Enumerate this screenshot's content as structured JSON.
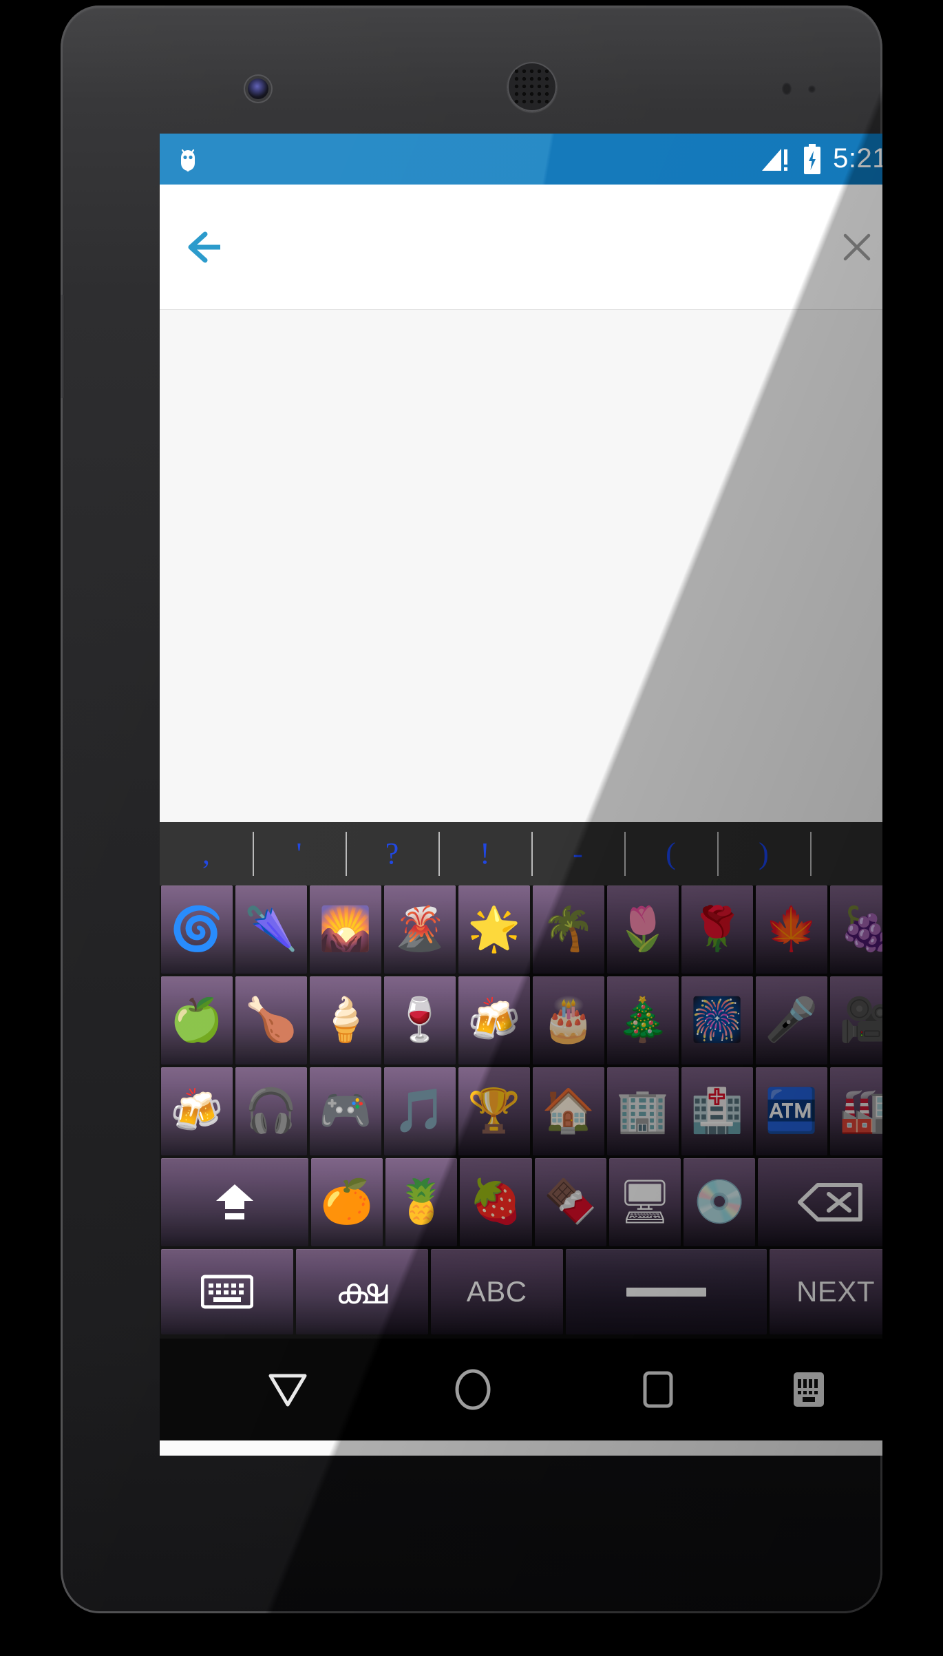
{
  "device": {
    "name": "android-phone-nexus",
    "hardware": [
      "front-camera",
      "earpiece",
      "proximity-sensor",
      "power-button",
      "volume-button"
    ]
  },
  "status_bar": {
    "notification_icon": "android-robot-icon",
    "signal_icon": "signal-triangle-warning-icon",
    "battery_icon": "battery-charging-icon",
    "clock": "5:21",
    "background_color": "#1f86c4"
  },
  "app_bar": {
    "back_icon": "back-arrow-icon",
    "back_color": "#2196c9",
    "close_icon": "close-x-icon",
    "close_color": "#9e9e9e",
    "background_color": "#ffffff",
    "title": ""
  },
  "content": {
    "text": "",
    "background_color": "#f7f7f7"
  },
  "keyboard": {
    "theme_key_color": "#6e5578",
    "suggestion_text_color": "#1840e0",
    "suggestion_bar_color": "#2c2c2c",
    "suggestions": [
      {
        "label": ",",
        "name": "comma"
      },
      {
        "label": "'",
        "name": "apostrophe"
      },
      {
        "label": "?",
        "name": "question-mark"
      },
      {
        "label": "!",
        "name": "exclamation-mark"
      },
      {
        "label": "-",
        "name": "hyphen"
      },
      {
        "label": "(",
        "name": "open-paren"
      },
      {
        "label": ")",
        "name": "close-paren"
      },
      {
        "label": "",
        "name": "empty"
      }
    ],
    "rows": [
      [
        {
          "glyph": "🌀",
          "name": "emoji-cyclone"
        },
        {
          "glyph": "🌂",
          "name": "emoji-closed-umbrella"
        },
        {
          "glyph": "🌄",
          "name": "emoji-sunrise-over-mountains"
        },
        {
          "glyph": "🌋",
          "name": "emoji-volcano"
        },
        {
          "glyph": "🌟",
          "name": "emoji-glowing-star"
        },
        {
          "glyph": "🌴",
          "name": "emoji-palm-tree"
        },
        {
          "glyph": "🌷",
          "name": "emoji-tulip"
        },
        {
          "glyph": "🌹",
          "name": "emoji-rose"
        },
        {
          "glyph": "🍁",
          "name": "emoji-maple-leaf"
        },
        {
          "glyph": "🍇",
          "name": "emoji-grapes"
        }
      ],
      [
        {
          "glyph": "🍏",
          "name": "emoji-green-apple"
        },
        {
          "glyph": "🍗",
          "name": "emoji-poultry-leg"
        },
        {
          "glyph": "🍦",
          "name": "emoji-soft-ice-cream"
        },
        {
          "glyph": "🍷",
          "name": "emoji-wine-glass"
        },
        {
          "glyph": "🍻",
          "name": "emoji-clinking-beer-mugs"
        },
        {
          "glyph": "🎂",
          "name": "emoji-birthday-cake"
        },
        {
          "glyph": "🎄",
          "name": "emoji-christmas-tree"
        },
        {
          "glyph": "🎆",
          "name": "emoji-fireworks"
        },
        {
          "glyph": "🎤",
          "name": "emoji-microphone"
        },
        {
          "glyph": "🎥",
          "name": "emoji-movie-camera"
        }
      ],
      [
        {
          "glyph": "🍻",
          "name": "emoji-clinking-beer-mugs-2"
        },
        {
          "glyph": "🎧",
          "name": "emoji-headphone"
        },
        {
          "glyph": "🎮",
          "name": "emoji-video-game"
        },
        {
          "glyph": "🎵",
          "name": "emoji-musical-note"
        },
        {
          "glyph": "🏆",
          "name": "emoji-trophy"
        },
        {
          "glyph": "🏠",
          "name": "emoji-house"
        },
        {
          "glyph": "🏢",
          "name": "emoji-office-building"
        },
        {
          "glyph": "🏥",
          "name": "emoji-hospital"
        },
        {
          "glyph": "🏧",
          "name": "emoji-atm-sign"
        },
        {
          "glyph": "🏭",
          "name": "emoji-factory"
        }
      ],
      [
        {
          "glyph": "",
          "name": "shift-key",
          "icon": "shift-up-arrow-icon",
          "width": "shift"
        },
        {
          "glyph": "🍊",
          "name": "emoji-tangerine"
        },
        {
          "glyph": "🍍",
          "name": "emoji-pineapple"
        },
        {
          "glyph": "🍓",
          "name": "emoji-strawberry"
        },
        {
          "glyph": "🍫",
          "name": "emoji-chocolate-bar"
        },
        {
          "glyph": "🖥",
          "name": "emoji-desktop-computer"
        },
        {
          "glyph": "💿",
          "name": "emoji-optical-disc"
        },
        {
          "glyph": "",
          "name": "backspace-key",
          "icon": "backspace-icon",
          "width": "wide2"
        }
      ]
    ],
    "function_row": [
      {
        "label": "",
        "name": "keyboard-switch-key",
        "icon": "keyboard-icon"
      },
      {
        "label": "ക്ഷ",
        "name": "language-switch-key",
        "icon": "malayalam-script-icon"
      },
      {
        "label": "ABC",
        "name": "abc-mode-key",
        "icon": ""
      },
      {
        "label": "",
        "name": "space-key",
        "icon": "space-bar-icon"
      },
      {
        "label": "NEXT",
        "name": "next-key",
        "icon": ""
      }
    ]
  },
  "nav_bar": {
    "background_color": "#000000",
    "items": [
      {
        "name": "back-button",
        "icon": "triangle-down-icon"
      },
      {
        "name": "home-button",
        "icon": "circle-icon"
      },
      {
        "name": "recents-button",
        "icon": "square-icon"
      },
      {
        "name": "keyboard-indicator",
        "icon": "keyboard-icon"
      }
    ]
  }
}
